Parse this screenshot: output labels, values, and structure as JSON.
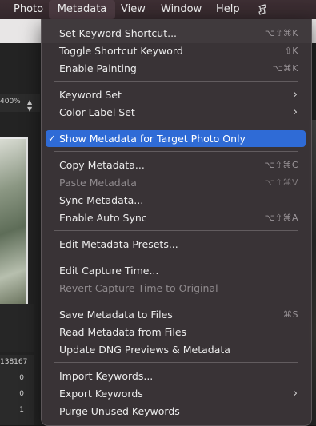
{
  "menubar": {
    "items": [
      "Photo",
      "Metadata",
      "View",
      "Window",
      "Help"
    ],
    "script_icon": "script-icon"
  },
  "background": {
    "zoom": "400%",
    "stats": [
      "138167",
      "0",
      "0",
      "1"
    ]
  },
  "menu": {
    "items": [
      {
        "label": "Set Keyword Shortcut...",
        "shortcut": "⌥⇧⌘K"
      },
      {
        "label": "Toggle Shortcut Keyword",
        "shortcut": "⇧K"
      },
      {
        "label": "Enable Painting",
        "shortcut": "⌥⌘K"
      },
      {
        "label": "Keyword Set",
        "shortcut": "",
        "submenu": true
      },
      {
        "label": "Color Label Set",
        "shortcut": "",
        "submenu": true
      },
      {
        "label": "Show Metadata for Target Photo Only",
        "shortcut": "",
        "checked": true
      },
      {
        "label": "Copy Metadata...",
        "shortcut": "⌥⇧⌘C"
      },
      {
        "label": "Paste Metadata",
        "shortcut": "⌥⇧⌘V",
        "disabled": true
      },
      {
        "label": "Sync Metadata...",
        "shortcut": ""
      },
      {
        "label": "Enable Auto Sync",
        "shortcut": "⌥⇧⌘A"
      },
      {
        "label": "Edit Metadata Presets...",
        "shortcut": ""
      },
      {
        "label": "Edit Capture Time...",
        "shortcut": ""
      },
      {
        "label": "Revert Capture Time to Original",
        "shortcut": "",
        "disabled": true
      },
      {
        "label": "Save Metadata to Files",
        "shortcut": "⌘S"
      },
      {
        "label": "Read Metadata from Files",
        "shortcut": ""
      },
      {
        "label": "Update DNG Previews & Metadata",
        "shortcut": ""
      },
      {
        "label": "Import Keywords...",
        "shortcut": ""
      },
      {
        "label": "Export Keywords",
        "shortcut": "",
        "submenu": true
      },
      {
        "label": "Purge Unused Keywords",
        "shortcut": ""
      }
    ],
    "checkmark": "✓",
    "submenu_arrow": "›"
  },
  "colors": {
    "selection": "#2f6bd6",
    "menu_bg": "#3a3437",
    "menubar_bg": "#3d2e33"
  }
}
